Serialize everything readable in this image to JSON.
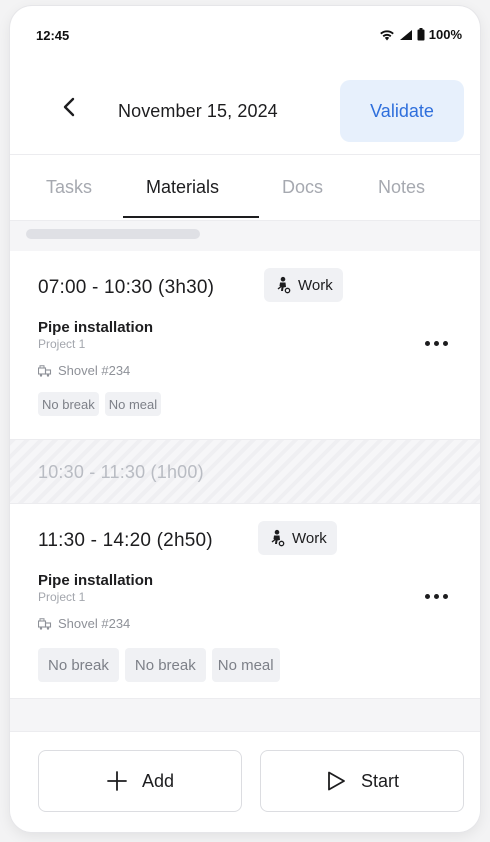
{
  "status_bar": {
    "time": "12:45",
    "battery": "100%"
  },
  "header": {
    "date": "November 15, 2024",
    "validate_label": "Validate"
  },
  "tabs": [
    {
      "label": "Tasks",
      "active": false
    },
    {
      "label": "Materials",
      "active": true
    },
    {
      "label": "Docs",
      "active": false
    },
    {
      "label": "Notes",
      "active": false
    }
  ],
  "entries": [
    {
      "time_range": "07:00 - 10:30  (3h30)",
      "type_label": "Work",
      "task": "Pipe installation",
      "project": "Project 1",
      "material": "Shovel #234",
      "tags": [
        "No break",
        "No meal"
      ]
    },
    {
      "time_range": "11:30 - 14:20  (2h50)",
      "type_label": "Work",
      "task": "Pipe installation",
      "project": "Project 1",
      "material": "Shovel #234",
      "tags": [
        "No break",
        "No break",
        "No meal"
      ]
    }
  ],
  "break": {
    "time_range": "10:30 - 11:30  (1h00)"
  },
  "bottom_bar": {
    "add_label": "Add",
    "start_label": "Start"
  },
  "colors": {
    "accent": "#2f6fdc",
    "accent_bg": "#e7f0fc",
    "text_primary": "#1d1d1f",
    "text_muted": "#a6a9b0"
  },
  "icons": {
    "back": "chevron-left-icon",
    "work": "worker-icon",
    "material": "tool-icon",
    "more": "more-horizontal-icon",
    "add": "plus-icon",
    "start": "play-icon"
  }
}
